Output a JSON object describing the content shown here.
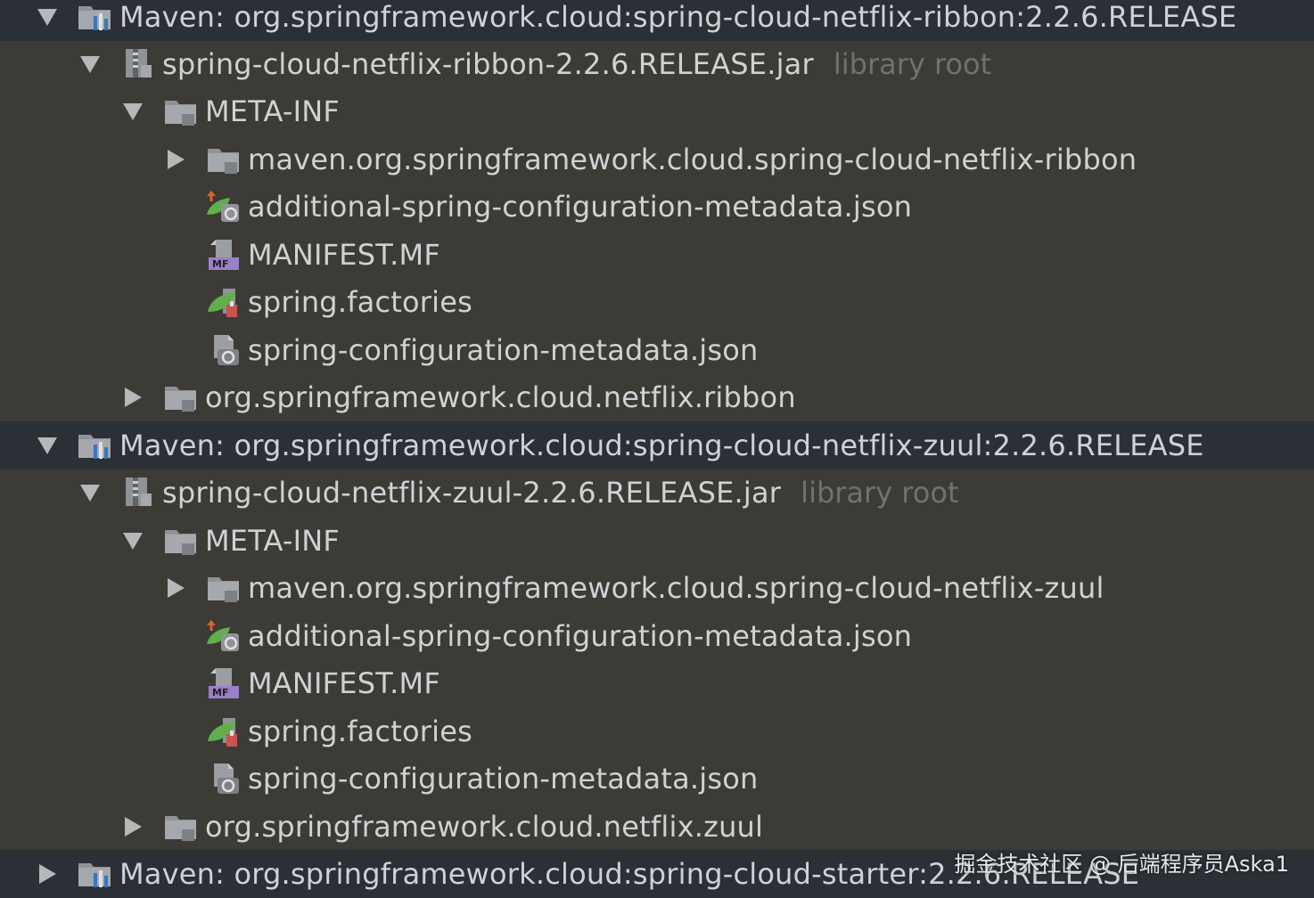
{
  "tree": {
    "rows": [
      {
        "label": "Maven: org.springframework.cloud:spring-cloud-netflix-ribbon:2.2.6.RELEASE",
        "hint": "",
        "icon": "maven-library-icon",
        "expander": "expanded",
        "selected": true
      },
      {
        "label": "spring-cloud-netflix-ribbon-2.2.6.RELEASE.jar",
        "hint": "library root",
        "icon": "jar-archive-icon",
        "expander": "expanded",
        "selected": false
      },
      {
        "label": "META-INF",
        "hint": "",
        "icon": "folder-icon",
        "expander": "expanded",
        "selected": false
      },
      {
        "label": "maven.org.springframework.cloud.spring-cloud-netflix-ribbon",
        "hint": "",
        "icon": "folder-icon",
        "expander": "collapsed",
        "selected": false
      },
      {
        "label": "additional-spring-configuration-metadata.json",
        "hint": "",
        "icon": "spring-json-icon",
        "expander": "none",
        "selected": false
      },
      {
        "label": "MANIFEST.MF",
        "hint": "",
        "icon": "manifest-file-icon",
        "expander": "none",
        "selected": false
      },
      {
        "label": "spring.factories",
        "hint": "",
        "icon": "spring-factories-icon",
        "expander": "none",
        "selected": false
      },
      {
        "label": "spring-configuration-metadata.json",
        "hint": "",
        "icon": "json-file-icon",
        "expander": "none",
        "selected": false
      },
      {
        "label": "org.springframework.cloud.netflix.ribbon",
        "hint": "",
        "icon": "folder-icon",
        "expander": "collapsed",
        "selected": false
      },
      {
        "label": "Maven: org.springframework.cloud:spring-cloud-netflix-zuul:2.2.6.RELEASE",
        "hint": "",
        "icon": "maven-library-icon",
        "expander": "expanded",
        "selected": true
      },
      {
        "label": "spring-cloud-netflix-zuul-2.2.6.RELEASE.jar",
        "hint": "library root",
        "icon": "jar-archive-icon",
        "expander": "expanded",
        "selected": false
      },
      {
        "label": "META-INF",
        "hint": "",
        "icon": "folder-icon",
        "expander": "expanded",
        "selected": false
      },
      {
        "label": "maven.org.springframework.cloud.spring-cloud-netflix-zuul",
        "hint": "",
        "icon": "folder-icon",
        "expander": "collapsed",
        "selected": false
      },
      {
        "label": "additional-spring-configuration-metadata.json",
        "hint": "",
        "icon": "spring-json-icon",
        "expander": "none",
        "selected": false
      },
      {
        "label": "MANIFEST.MF",
        "hint": "",
        "icon": "manifest-file-icon",
        "expander": "none",
        "selected": false
      },
      {
        "label": "spring.factories",
        "hint": "",
        "icon": "spring-factories-icon",
        "expander": "none",
        "selected": false
      },
      {
        "label": "spring-configuration-metadata.json",
        "hint": "",
        "icon": "json-file-icon",
        "expander": "none",
        "selected": false
      },
      {
        "label": "org.springframework.cloud.netflix.zuul",
        "hint": "",
        "icon": "folder-icon",
        "expander": "collapsed",
        "selected": false
      },
      {
        "label": "Maven: org.springframework.cloud:spring-cloud-starter:2.2.6.RELEASE",
        "hint": "",
        "icon": "maven-library-icon",
        "expander": "collapsed",
        "selected": true
      }
    ]
  },
  "watermark": "掘金技术社区 @ 后端程序员Aska1",
  "colors": {
    "background": "#3c3b36",
    "selected_row": "#2b2f36",
    "text": "#cfd2d5",
    "hint_text": "#6f7173",
    "spring_green": "#6ab04c"
  }
}
